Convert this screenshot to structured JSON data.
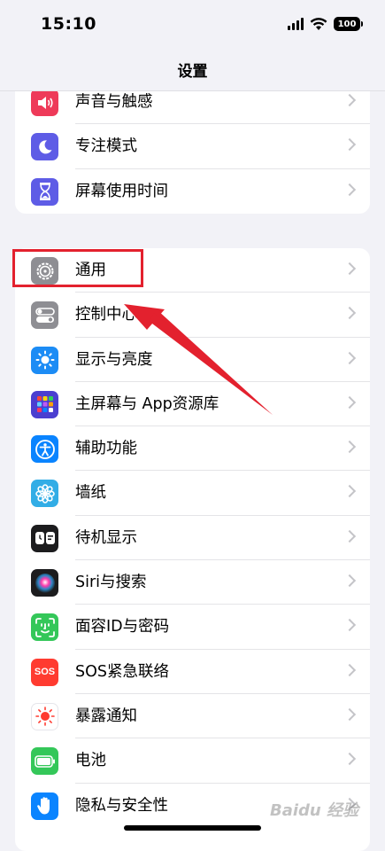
{
  "status_bar": {
    "time": "15:10",
    "battery": "100"
  },
  "nav": {
    "title": "设置"
  },
  "group1": [
    {
      "label": "声音与触感",
      "icon": "speaker-icon",
      "color": "#ee3a59"
    },
    {
      "label": "专注模式",
      "icon": "moon-icon",
      "color": "#5e5ce6"
    },
    {
      "label": "屏幕使用时间",
      "icon": "hourglass-icon",
      "color": "#5e5ce6"
    }
  ],
  "group2": [
    {
      "label": "通用",
      "icon": "gear-icon",
      "color": "#8e8e93"
    },
    {
      "label": "控制中心",
      "icon": "toggles-icon",
      "color": "#8e8e93"
    },
    {
      "label": "显示与亮度",
      "icon": "sun-icon",
      "color": "#1c8cf5"
    },
    {
      "label": "主屏幕与 App资源库",
      "icon": "app-grid-icon",
      "color": "#5856d6"
    },
    {
      "label": "辅助功能",
      "icon": "accessibility-icon",
      "color": "#0a84ff"
    },
    {
      "label": "墙纸",
      "icon": "flower-icon",
      "color": "#32ade6"
    },
    {
      "label": "待机显示",
      "icon": "standby-icon",
      "color": "#1c1c1e"
    },
    {
      "label": "Siri与搜索",
      "icon": "siri-icon",
      "color": "#1c1c1e"
    },
    {
      "label": "面容ID与密码",
      "icon": "faceid-icon",
      "color": "#34c759"
    },
    {
      "label": "SOS紧急联络",
      "icon": "sos-icon",
      "color": "#ff3b30"
    },
    {
      "label": "暴露通知",
      "icon": "exposure-icon",
      "color": "#ffffff"
    },
    {
      "label": "电池",
      "icon": "battery-icon",
      "color": "#34c759"
    },
    {
      "label": "隐私与安全性",
      "icon": "hand-icon",
      "color": "#0a84ff"
    }
  ],
  "icon_text": {
    "sos": "SOS"
  },
  "watermark": "Baidu 经验",
  "colors": {
    "highlight": "#e3212e",
    "background": "#f2f2f7"
  }
}
